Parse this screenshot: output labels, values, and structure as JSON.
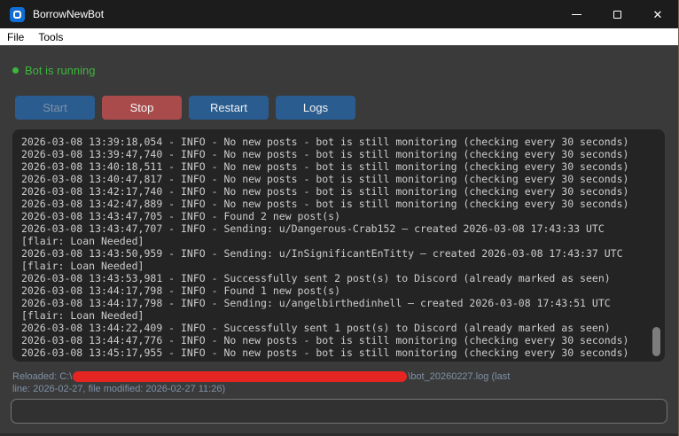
{
  "window": {
    "title": "BorrowNewBot",
    "controls": {
      "minimize": "minimize",
      "maximize": "maximize",
      "close": "✕"
    }
  },
  "menu": {
    "items": [
      {
        "label": "File"
      },
      {
        "label": "Tools"
      }
    ]
  },
  "status": {
    "text": "Bot is running",
    "color": "#3cb63c"
  },
  "toolbar": {
    "buttons": [
      {
        "label": "Start",
        "state": "disabled",
        "color": "#2a5c8f"
      },
      {
        "label": "Stop",
        "state": "enabled",
        "color": "#aa4b4b"
      },
      {
        "label": "Restart",
        "state": "enabled",
        "color": "#2a5c8f"
      },
      {
        "label": "Logs",
        "state": "enabled",
        "color": "#2a5c8f"
      }
    ]
  },
  "log": {
    "lines": [
      "2026-03-08 13:39:18,054 - INFO - No new posts - bot is still monitoring (checking every 30 seconds)",
      "2026-03-08 13:39:47,740 - INFO - No new posts - bot is still monitoring (checking every 30 seconds)",
      "2026-03-08 13:40:18,511 - INFO - No new posts - bot is still monitoring (checking every 30 seconds)",
      "2026-03-08 13:40:47,817 - INFO - No new posts - bot is still monitoring (checking every 30 seconds)",
      "2026-03-08 13:42:17,740 - INFO - No new posts - bot is still monitoring (checking every 30 seconds)",
      "2026-03-08 13:42:47,889 - INFO - No new posts - bot is still monitoring (checking every 30 seconds)",
      "2026-03-08 13:43:47,705 - INFO - Found 2 new post(s)",
      "2026-03-08 13:43:47,707 - INFO - Sending: u/Dangerous-Crab152 — created 2026-03-08 17:43:33 UTC",
      "[flair: Loan Needed]",
      "2026-03-08 13:43:50,959 - INFO - Sending: u/InSignificantEnTitty — created 2026-03-08 17:43:37 UTC",
      "[flair: Loan Needed]",
      "2026-03-08 13:43:53,981 - INFO - Successfully sent 2 post(s) to Discord (already marked as seen)",
      "2026-03-08 13:44:17,798 - INFO - Found 1 new post(s)",
      "2026-03-08 13:44:17,798 - INFO - Sending: u/angelbirthedinhell — created 2026-03-08 17:43:51 UTC",
      "[flair: Loan Needed]",
      "2026-03-08 13:44:22,409 - INFO - Successfully sent 1 post(s) to Discord (already marked as seen)",
      "2026-03-08 13:44:47,776 - INFO - No new posts - bot is still monitoring (checking every 30 seconds)",
      "2026-03-08 13:45:17,955 - INFO - No new posts - bot is still monitoring (checking every 30 seconds)"
    ]
  },
  "statusbar": {
    "prefix": "Reloaded: C:\\",
    "redacted": true,
    "suffix": "\\bot_20260227.log (last",
    "line2": "line: 2026-02-27, file modified: 2026-02-27 11:26)"
  },
  "input": {
    "value": "",
    "placeholder": ""
  }
}
